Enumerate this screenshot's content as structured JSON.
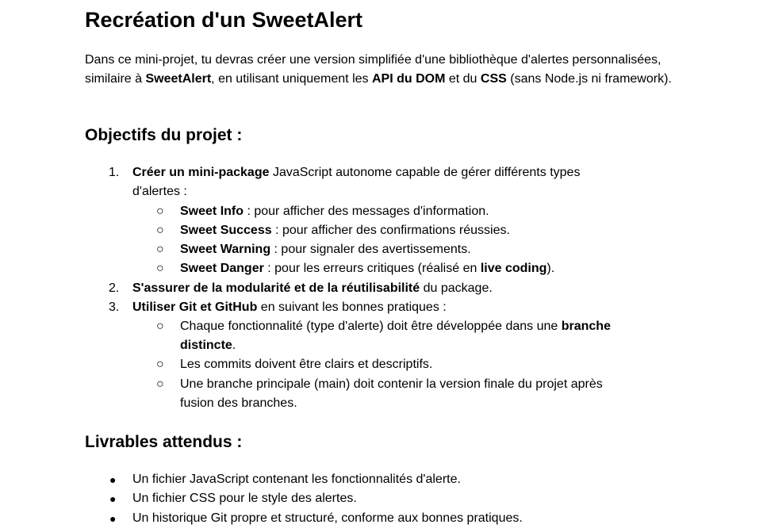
{
  "title": "Recréation d'un SweetAlert",
  "intro": {
    "t1": "Dans ce mini-projet, tu devras créer une version simplifiée d'une bibliothèque d'alertes personnalisées, similaire à ",
    "b1": "SweetAlert",
    "t2": ", en utilisant uniquement les ",
    "b2": "API du DOM",
    "t3": " et du ",
    "b3": "CSS",
    "t4": " (sans Node.js ni framework)."
  },
  "objectives": {
    "heading": "Objectifs du projet :",
    "item1": {
      "marker": "1.",
      "bold": "Créer un mini-package",
      "rest_line1": " JavaScript autonome capable de gérer différents types",
      "rest_line2": "d'alertes :",
      "sub": [
        {
          "bold": "Sweet Info",
          "rest": " : pour afficher des messages d'information."
        },
        {
          "bold": "Sweet Success",
          "rest": " : pour afficher des confirmations réussies."
        },
        {
          "bold": "Sweet Warning",
          "rest": " : pour signaler des avertissements."
        },
        {
          "bold": "Sweet Danger",
          "rest": " : pour les erreurs critiques (réalisé en ",
          "bold2": "live coding",
          "rest2": ")."
        }
      ]
    },
    "item2": {
      "marker": "2.",
      "bold": "S'assurer de la modularité et de la réutilisabilité",
      "rest": " du package."
    },
    "item3": {
      "marker": "3.",
      "bold": "Utiliser Git et GitHub",
      "rest": " en suivant les bonnes pratiques :",
      "sub1": {
        "text": "Chaque fonctionnalité (type d'alerte) doit être développée dans une ",
        "bold_a": "branche",
        "bold_b": "distincte",
        "end": "."
      },
      "sub2": "Les commits doivent être clairs et descriptifs.",
      "sub3_line1": "Une branche principale (main) doit contenir la version finale du projet après",
      "sub3_line2": "fusion des branches."
    },
    "sub_marker": "○"
  },
  "deliverables": {
    "heading": "Livrables attendus :",
    "marker": "●",
    "items": [
      "Un fichier JavaScript contenant les fonctionnalités d'alerte.",
      "Un fichier CSS pour le style des alertes.",
      "Un historique Git propre et structuré, conforme aux bonnes pratiques."
    ]
  }
}
